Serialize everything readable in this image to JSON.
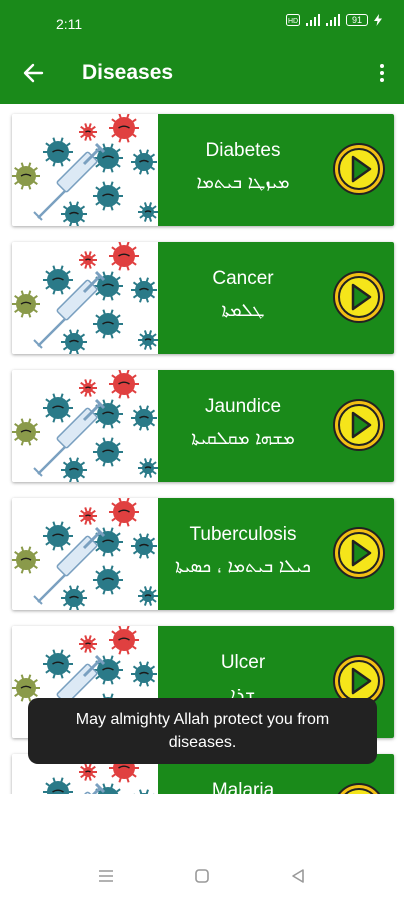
{
  "status_bar": {
    "time": "2:11",
    "battery": "91"
  },
  "app_bar": {
    "title": "Diseases"
  },
  "colors": {
    "primary": "#1a8a1a",
    "play_fill": "#f5e51a",
    "play_ring": "#f3bf14",
    "toast_bg": "#222222"
  },
  "diseases": [
    {
      "name": "Diabetes",
      "native": "ܡܝܙܛܐ ܒܝܬܡܐ"
    },
    {
      "name": "Cancer",
      "native": "ܛܠܡܬܐ"
    },
    {
      "name": "Jaundice",
      "native": "ܡܫܗܐ ܡܩܠܩܝܬܐ"
    },
    {
      "name": "Tuberculosis",
      "native": "ܟܝܠܐ ܒܝܬܡܐ ، ܟܣܝܬܐ"
    },
    {
      "name": "Ulcer",
      "native": "ܫܪܐ"
    },
    {
      "name": "Malaria",
      "native": ""
    }
  ],
  "toast": {
    "message": "May almighty Allah protect you from diseases."
  },
  "nav": {
    "menu_icon": "menu-lines-icon",
    "home_icon": "square-home-icon",
    "back_icon": "triangle-back-icon"
  }
}
